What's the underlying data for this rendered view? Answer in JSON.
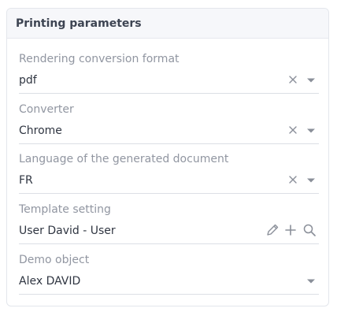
{
  "panel": {
    "title": "Printing parameters"
  },
  "fields": [
    {
      "label": "Rendering conversion format",
      "value": "pdf",
      "icons": [
        "clear-icon",
        "dropdown-caret-icon"
      ]
    },
    {
      "label": "Converter",
      "value": "Chrome",
      "icons": [
        "clear-icon",
        "dropdown-caret-icon"
      ]
    },
    {
      "label": "Language of the generated document",
      "value": "FR",
      "icons": [
        "clear-icon",
        "dropdown-caret-icon"
      ]
    },
    {
      "label": "Template setting",
      "value": "User David - User",
      "icons": [
        "pencil-edit-icon",
        "plus-icon",
        "search-icon"
      ]
    },
    {
      "label": "Demo object",
      "value": "Alex DAVID",
      "icons": [
        "dropdown-caret-icon"
      ]
    }
  ],
  "colors": {
    "label": "#9196a1",
    "value": "#2f3541",
    "icon": "#8a8f99",
    "border": "#dcdfe5",
    "header_bg": "#f6f7fa"
  }
}
